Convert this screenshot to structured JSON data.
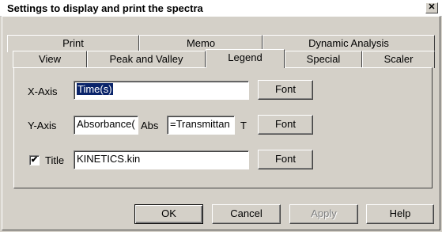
{
  "window": {
    "title": "Settings to display and print the spectra",
    "close_glyph": "✕"
  },
  "tabs_row1": [
    "Print",
    "Memo",
    "Dynamic Analysis"
  ],
  "tabs_row2": [
    "View",
    "Peak and Valley",
    "Legend",
    "Special",
    "Scaler"
  ],
  "active_tab": "Legend",
  "legend": {
    "x_axis": {
      "label": "X-Axis",
      "value": "Time(s)",
      "font_button": "Font"
    },
    "y_axis": {
      "label": "Y-Axis",
      "value1": "Absorbance(",
      "unit1": "Abs",
      "value2": "=Transmittan",
      "unit2": "T",
      "font_button": "Font"
    },
    "title": {
      "label": "Title",
      "checked": true,
      "check_glyph": "✔",
      "value": "KINETICS.kin",
      "font_button": "Font"
    }
  },
  "buttons": {
    "ok": "OK",
    "cancel": "Cancel",
    "apply": "Apply",
    "help": "Help"
  }
}
